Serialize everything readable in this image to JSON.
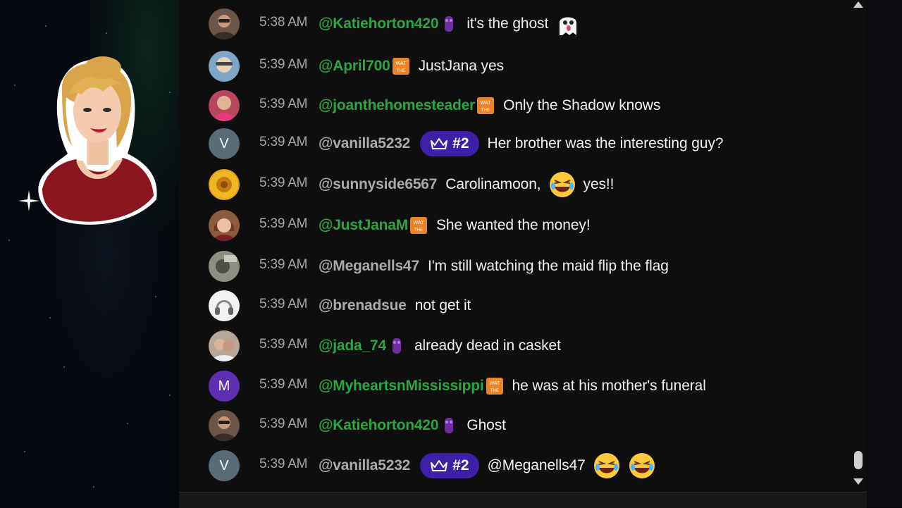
{
  "colors": {
    "member_name": "#2ba640",
    "plain_name": "#aaaaaa",
    "message_text": "#f1f1f1",
    "timestamp": "#a6a6a6",
    "rank_badge_bg": "#3d1fa8",
    "chat_bg": "#0f0f0f"
  },
  "messages": [
    {
      "time": "5:38 AM",
      "author": "@Katiehorton420",
      "message": "it's the ghost",
      "emoji": "ghost-emoji",
      "badge": "purple-member-badge"
    },
    {
      "time": "5:39 AM",
      "author": "@April700",
      "message": "JustJana yes",
      "badge": "wat-member-badge"
    },
    {
      "time": "5:39 AM",
      "author": "@joanthehomesteader",
      "message": "Only the Shadow knows",
      "badge": "wat-member-badge"
    },
    {
      "time": "5:39 AM",
      "author": "@vanilla5232",
      "message": "Her brother was the interesting guy?",
      "rank": "#2",
      "avatar_letter": "V"
    },
    {
      "time": "5:39 AM",
      "author": "@sunnyside6567",
      "message_before": "Carolinamoon,",
      "message_after": "yes!!",
      "emoji": "laughing-emoji"
    },
    {
      "time": "5:39 AM",
      "author": "@JustJanaM",
      "message": "She wanted the money!",
      "badge": "wat-member-badge"
    },
    {
      "time": "5:39 AM",
      "author": "@Meganells47",
      "message": "I'm still watching the maid flip the flag"
    },
    {
      "time": "5:39 AM",
      "author": "@brenadsue",
      "message": "not get it"
    },
    {
      "time": "5:39 AM",
      "author": "@jada_74",
      "message": "already dead in casket",
      "badge": "purple-member-badge"
    },
    {
      "time": "5:39 AM",
      "author": "@MyheartsnMississippi",
      "message": "he was at his mother's funeral",
      "badge": "wat-member-badge",
      "avatar_letter": "M"
    },
    {
      "time": "5:39 AM",
      "author": "@Katiehorton420",
      "message": "Ghost",
      "badge": "purple-member-badge"
    },
    {
      "time": "5:39 AM",
      "author": "@vanilla5232",
      "message": "@Meganells47",
      "rank": "#2",
      "emoji": "laughing-emoji",
      "avatar_letter": "V"
    }
  ],
  "badges": {
    "wat_text_top": "WAT",
    "wat_text_bottom": "THE"
  }
}
